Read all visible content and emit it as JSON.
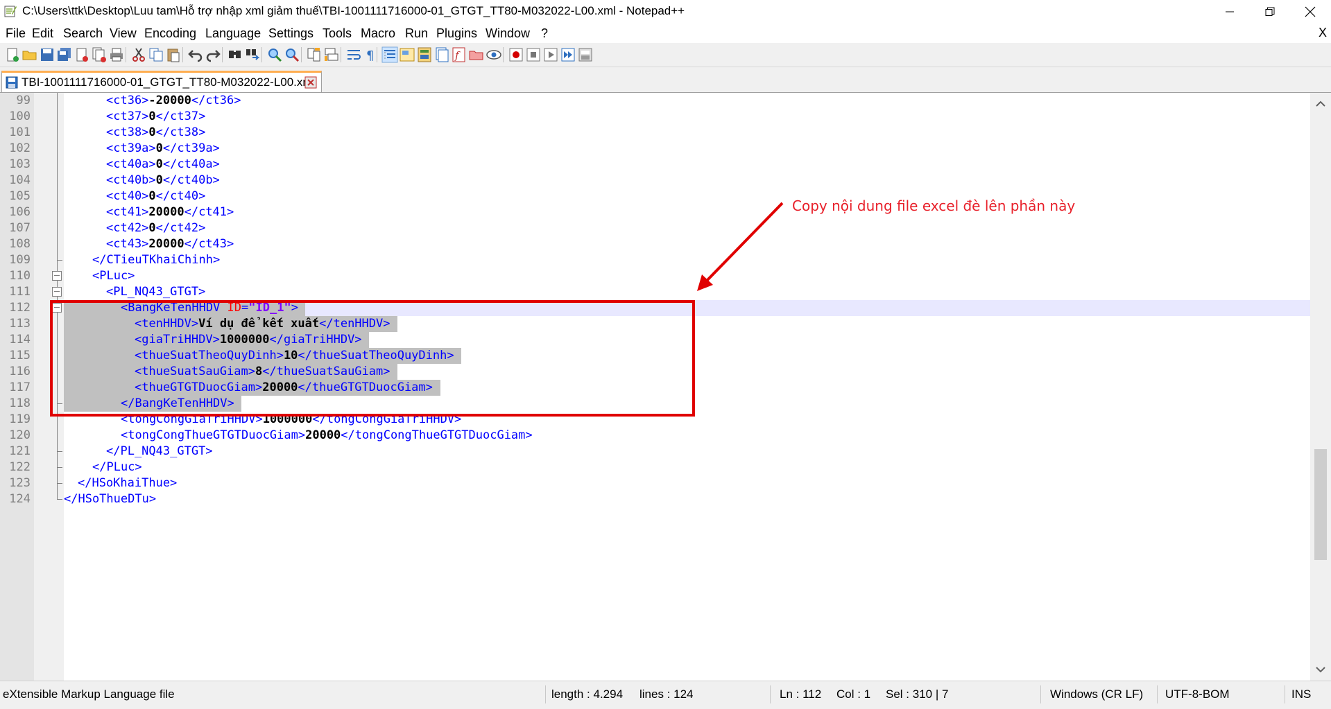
{
  "window": {
    "title": "C:\\Users\\ttk\\Desktop\\Luu tam\\Hỗ trợ nhập xml giảm thuế\\TBI-1001111716000-01_GTGT_TT80-M032022-L00.xml - Notepad++",
    "minimize_icon": "minimize-icon",
    "maximize_icon": "restore-icon",
    "close_icon": "close-icon"
  },
  "menu": {
    "items": [
      "File",
      "Edit",
      "Search",
      "View",
      "Encoding",
      "Language",
      "Settings",
      "Tools",
      "Macro",
      "Run",
      "Plugins",
      "Window",
      "?"
    ],
    "close_label": "X"
  },
  "toolbar": {
    "buttons": [
      "new-file",
      "open-file",
      "save",
      "save-all",
      "close",
      "close-all",
      "print",
      "cut",
      "copy",
      "paste",
      "undo",
      "redo",
      "find",
      "replace",
      "zoom-in",
      "zoom-out",
      "sync-vertical",
      "sync-horizontal",
      "word-wrap",
      "show-all-chars",
      "indent-guide",
      "user-defined-language",
      "document-map",
      "document-list",
      "function-list",
      "folder-as-workspace",
      "monitoring",
      "record-macro",
      "stop-recording",
      "play-macro",
      "run-macro-multiple",
      "save-macro"
    ]
  },
  "tabs": [
    {
      "label": "TBI-1001111716000-01_GTGT_TT80-M032022-L00.xml",
      "icon": "save-icon",
      "close_icon": "close-tab-icon"
    }
  ],
  "editor": {
    "current_line": 112,
    "lines": [
      {
        "n": "99",
        "i": 3,
        "parts": [
          [
            "t",
            "<ct36>"
          ],
          [
            "v",
            "-20000"
          ],
          [
            "t",
            "</ct36>"
          ]
        ]
      },
      {
        "n": "100",
        "i": 3,
        "parts": [
          [
            "t",
            "<ct37>"
          ],
          [
            "v",
            "0"
          ],
          [
            "t",
            "</ct37>"
          ]
        ]
      },
      {
        "n": "101",
        "i": 3,
        "parts": [
          [
            "t",
            "<ct38>"
          ],
          [
            "v",
            "0"
          ],
          [
            "t",
            "</ct38>"
          ]
        ]
      },
      {
        "n": "102",
        "i": 3,
        "parts": [
          [
            "t",
            "<ct39a>"
          ],
          [
            "v",
            "0"
          ],
          [
            "t",
            "</ct39a>"
          ]
        ]
      },
      {
        "n": "103",
        "i": 3,
        "parts": [
          [
            "t",
            "<ct40a>"
          ],
          [
            "v",
            "0"
          ],
          [
            "t",
            "</ct40a>"
          ]
        ]
      },
      {
        "n": "104",
        "i": 3,
        "parts": [
          [
            "t",
            "<ct40b>"
          ],
          [
            "v",
            "0"
          ],
          [
            "t",
            "</ct40b>"
          ]
        ]
      },
      {
        "n": "105",
        "i": 3,
        "parts": [
          [
            "t",
            "<ct40>"
          ],
          [
            "v",
            "0"
          ],
          [
            "t",
            "</ct40>"
          ]
        ]
      },
      {
        "n": "106",
        "i": 3,
        "parts": [
          [
            "t",
            "<ct41>"
          ],
          [
            "v",
            "20000"
          ],
          [
            "t",
            "</ct41>"
          ]
        ]
      },
      {
        "n": "107",
        "i": 3,
        "parts": [
          [
            "t",
            "<ct42>"
          ],
          [
            "v",
            "0"
          ],
          [
            "t",
            "</ct42>"
          ]
        ]
      },
      {
        "n": "108",
        "i": 3,
        "parts": [
          [
            "t",
            "<ct43>"
          ],
          [
            "v",
            "20000"
          ],
          [
            "t",
            "</ct43>"
          ]
        ]
      },
      {
        "n": "109",
        "i": 2,
        "parts": [
          [
            "t",
            "</CTieuTKhaiChinh>"
          ]
        ]
      },
      {
        "n": "110",
        "i": 2,
        "parts": [
          [
            "t",
            "<PLuc>"
          ]
        ]
      },
      {
        "n": "111",
        "i": 3,
        "parts": [
          [
            "t",
            "<PL_NQ43_GTGT>"
          ]
        ]
      },
      {
        "n": "112",
        "i": 4,
        "parts": [
          [
            "t",
            "<BangKeTenHHDV "
          ],
          [
            "a",
            "ID"
          ],
          [
            "t",
            "="
          ],
          [
            "q",
            "\"ID_1\""
          ],
          [
            "t",
            ">"
          ]
        ]
      },
      {
        "n": "113",
        "i": 5,
        "parts": [
          [
            "t",
            "<tenHHDV>"
          ],
          [
            "v",
            "Ví dụ để kết xuất"
          ],
          [
            "t",
            "</tenHHDV>"
          ]
        ]
      },
      {
        "n": "114",
        "i": 5,
        "parts": [
          [
            "t",
            "<giaTriHHDV>"
          ],
          [
            "v",
            "1000000"
          ],
          [
            "t",
            "</giaTriHHDV>"
          ]
        ]
      },
      {
        "n": "115",
        "i": 5,
        "parts": [
          [
            "t",
            "<thueSuatTheoQuyDinh>"
          ],
          [
            "v",
            "10"
          ],
          [
            "t",
            "</thueSuatTheoQuyDinh>"
          ]
        ]
      },
      {
        "n": "116",
        "i": 5,
        "parts": [
          [
            "t",
            "<thueSuatSauGiam>"
          ],
          [
            "v",
            "8"
          ],
          [
            "t",
            "</thueSuatSauGiam>"
          ]
        ]
      },
      {
        "n": "117",
        "i": 5,
        "parts": [
          [
            "t",
            "<thueGTGTDuocGiam>"
          ],
          [
            "v",
            "20000"
          ],
          [
            "t",
            "</thueGTGTDuocGiam>"
          ]
        ]
      },
      {
        "n": "118",
        "i": 4,
        "parts": [
          [
            "t",
            "</BangKeTenHHDV>"
          ]
        ]
      },
      {
        "n": "119",
        "i": 4,
        "parts": [
          [
            "t",
            "<tongCongGiaTriHHDV>"
          ],
          [
            "v",
            "1000000"
          ],
          [
            "t",
            "</tongCongGiaTriHHDV>"
          ]
        ]
      },
      {
        "n": "120",
        "i": 4,
        "parts": [
          [
            "t",
            "<tongCongThueGTGTDuocGiam>"
          ],
          [
            "v",
            "20000"
          ],
          [
            "t",
            "</tongCongThueGTGTDuocGiam>"
          ]
        ]
      },
      {
        "n": "121",
        "i": 3,
        "parts": [
          [
            "t",
            "</PL_NQ43_GTGT>"
          ]
        ]
      },
      {
        "n": "122",
        "i": 2,
        "parts": [
          [
            "t",
            "</PLuc>"
          ]
        ]
      },
      {
        "n": "123",
        "i": 1,
        "parts": [
          [
            "t",
            "</HSoKhaiThue>"
          ]
        ]
      },
      {
        "n": "124",
        "i": 0,
        "parts": [
          [
            "t",
            "</HSoThueDTu>"
          ]
        ]
      }
    ],
    "selected_lines": [
      "112",
      "113",
      "114",
      "115",
      "116",
      "117",
      "118"
    ]
  },
  "annotation": {
    "text": "Copy nội dung file excel đè lên phần này",
    "color": "#e00000"
  },
  "statusbar": {
    "file_type": "eXtensible Markup Language file",
    "length": "length : 4.294",
    "lines": "lines : 124",
    "ln": "Ln : 112",
    "col": "Col : 1",
    "sel": "Sel : 310 | 7",
    "eol": "Windows (CR LF)",
    "encoding": "UTF-8-BOM",
    "mode": "INS"
  },
  "colors": {
    "tag": "#0000ff",
    "attribute": "#ff0000",
    "attr_value": "#8000ff",
    "selection": "#c0c0c0",
    "current_line": "#e8e8ff",
    "active_tab_accent": "#ffae52"
  }
}
